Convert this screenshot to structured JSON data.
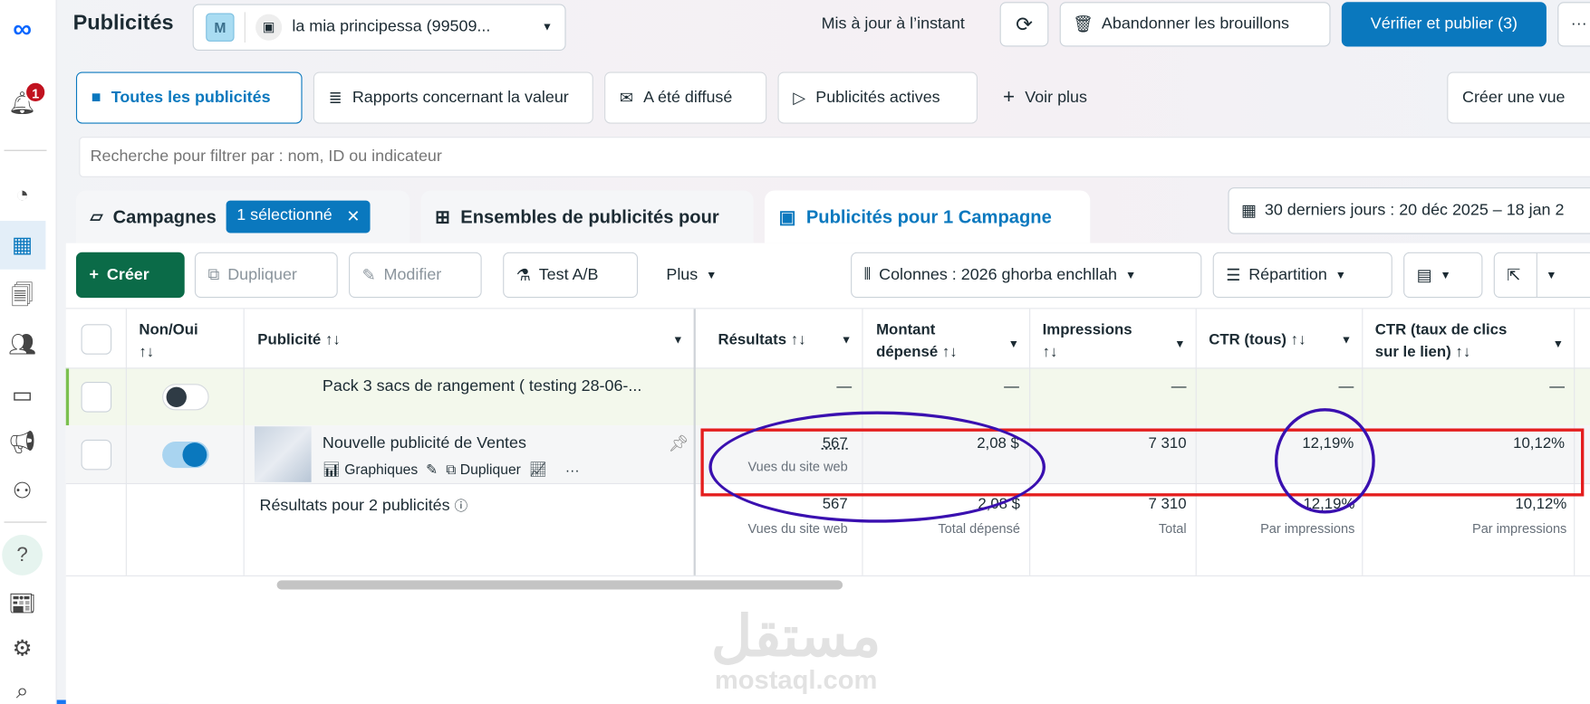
{
  "app": {
    "title": "Publicités",
    "notification_count": "1"
  },
  "account": {
    "initial": "M",
    "name": "la mia principessa (99509..."
  },
  "header": {
    "status": "Mis à jour à l’instant",
    "discard": "Abandonner les brouillons",
    "publish": "Vérifier et publier (3)",
    "more": "···"
  },
  "view_tabs": [
    {
      "label": "Toutes les publicités"
    },
    {
      "label": "Rapports concernant la valeur"
    },
    {
      "label": "A été diffusé"
    },
    {
      "label": "Publicités actives"
    },
    {
      "label": "Voir plus"
    }
  ],
  "create_view": "Créer une vue",
  "search": {
    "placeholder": "Recherche pour filtrer par : nom, ID ou indicateur"
  },
  "levels": {
    "campaigns": "Campagnes",
    "campaigns_selected": "1 sélectionné",
    "adsets": "Ensembles de publicités pour",
    "ads": "Publicités pour 1 Campagne"
  },
  "date_range": "30 derniers jours : 20 déc 2025 – 18 jan 2",
  "toolbar": {
    "create": "Créer",
    "duplicate": "Dupliquer",
    "edit": "Modifier",
    "abtest": "Test A/B",
    "more": "Plus",
    "columns": "Colonnes : 2026 ghorba enchllah",
    "breakdown": "Répartition"
  },
  "table": {
    "headers": {
      "toggle": "Non/Oui",
      "ad": "Publicité",
      "results": "Résultats",
      "spent1": "Montant",
      "spent2": "dépensé",
      "impressions": "Impressions",
      "ctr": "CTR (tous)",
      "ctr_link1": "CTR (taux de clics",
      "ctr_link2": "sur le lien)",
      "sort": "↑↓"
    },
    "rows": [
      {
        "name": "Pack 3 sacs de rangement ( testing 28-06-...",
        "enabled": false,
        "results": "—",
        "spent": "—",
        "impressions": "—",
        "ctr": "—",
        "ctr_link": "—"
      },
      {
        "name": "Nouvelle publicité de Ventes",
        "enabled": true,
        "results": "567",
        "results_sub": "Vues du site web",
        "spent": "2,08 $",
        "impressions": "7 310",
        "ctr": "12,19%",
        "ctr_link": "10,12%",
        "actions": {
          "charts": "Graphiques",
          "duplicate": "Dupliquer",
          "more": "···"
        }
      }
    ],
    "summary": {
      "label": "Résultats pour 2 publicités",
      "results": "567",
      "results_sub": "Vues du site web",
      "spent": "2,08 $",
      "spent_sub": "Total dépensé",
      "impressions": "7 310",
      "impressions_sub": "Total",
      "ctr": "12,19%",
      "ctr_sub": "Par impressions",
      "ctr_link": "10,12%",
      "ctr_link_sub": "Par impressions"
    }
  },
  "watermark": {
    "arabic": "مستقل",
    "latin": "mostaql.com"
  },
  "colors": {
    "primary": "#0a78be",
    "create": "#0b6b48",
    "highlight_box": "#e41e1e",
    "ellipse": "#3a10b0"
  }
}
